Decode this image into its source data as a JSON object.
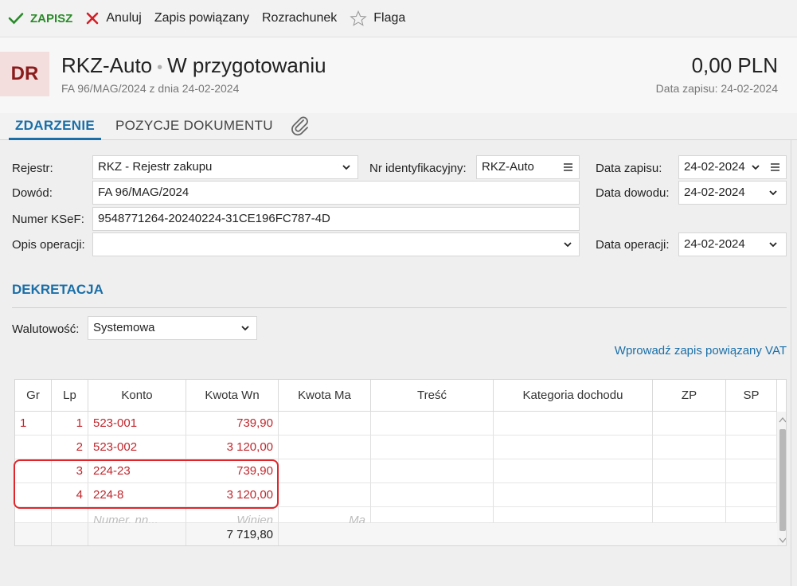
{
  "toolbar": {
    "save": "ZAPISZ",
    "cancel": "Anuluj",
    "linked": "Zapis powiązany",
    "settlement": "Rozrachunek",
    "flag": "Flaga"
  },
  "header": {
    "badge": "DR",
    "title": "RKZ-Auto",
    "status": "W przygotowaniu",
    "subtitle": "FA 96/MAG/2024 z dnia 24-02-2024",
    "amount": "0,00 PLN",
    "record_date": "Data zapisu: 24-02-2024"
  },
  "tabs": [
    "ZDARZENIE",
    "POZYCJE DOKUMENTU"
  ],
  "form": {
    "register_label": "Rejestr:",
    "register_value": "RKZ - Rejestr zakupu",
    "id_label": "Nr identyfikacyjny:",
    "id_value": "RKZ-Auto",
    "record_date_label": "Data zapisu:",
    "record_date_value": "24-02-2024",
    "proof_label": "Dowód:",
    "proof_value": "FA 96/MAG/2024",
    "proof_date_label": "Data dowodu:",
    "proof_date_value": "24-02-2024",
    "ksef_label": "Numer KSeF:",
    "ksef_value": "9548771264-20240224-31CE196FC787-4D",
    "op_desc_label": "Opis operacji:",
    "op_desc_value": "",
    "op_date_label": "Data operacji:",
    "op_date_value": "24-02-2024"
  },
  "dekretacja": {
    "title": "DEKRETACJA",
    "currency_label": "Walutowość:",
    "currency_value": "Systemowa",
    "vat_link": "Wprowadź zapis powiązany VAT",
    "columns": [
      "Gr",
      "Lp",
      "Konto",
      "Kwota Wn",
      "Kwota Ma",
      "Treść",
      "Kategoria dochodu",
      "ZP",
      "SP"
    ],
    "rows": [
      {
        "gr": "1",
        "lp": "1",
        "konto": "523-001",
        "wn": "739,90"
      },
      {
        "gr": "",
        "lp": "2",
        "konto": "523-002",
        "wn": "3 120,00"
      },
      {
        "gr": "",
        "lp": "3",
        "konto": "224-23",
        "wn": "739,90"
      },
      {
        "gr": "",
        "lp": "4",
        "konto": "224-8",
        "wn": "3 120,00"
      }
    ],
    "placeholders": {
      "konto": "Numer, nn...",
      "wn": "Winien",
      "ma": "Ma"
    },
    "total_wn": "7 719,80"
  },
  "colors": {
    "accent": "#1a6fa8",
    "error_red": "#c0262c",
    "save_green": "#2a8a2a",
    "badge_bg": "#f3dddd"
  }
}
